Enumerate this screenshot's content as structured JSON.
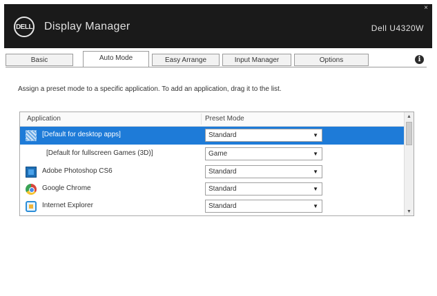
{
  "titlebar": {
    "logo_text": "DELL",
    "app_title": "Display Manager",
    "monitor_model": "Dell U4320W",
    "close_glyph": "×"
  },
  "tabs": [
    {
      "label": "Basic",
      "active": false
    },
    {
      "label": "Auto Mode",
      "active": true
    },
    {
      "label": "Easy Arrange",
      "active": false
    },
    {
      "label": "Input Manager",
      "active": false
    },
    {
      "label": "Options",
      "active": false
    }
  ],
  "info_glyph": "i",
  "instruction": "Assign a preset mode to a specific application. To add an application, drag it to the list.",
  "list": {
    "header_application": "Application",
    "header_preset": "Preset Mode",
    "rows": [
      {
        "label": "[Default for desktop apps]",
        "preset": "Standard",
        "icon": "default-apps-icon",
        "selected": true
      },
      {
        "label": "[Default for fullscreen Games (3D)]",
        "preset": "Game",
        "icon": "none",
        "selected": false
      },
      {
        "label": "Adobe Photoshop CS6",
        "preset": "Standard",
        "icon": "photoshop-icon",
        "selected": false
      },
      {
        "label": "Google Chrome",
        "preset": "Standard",
        "icon": "chrome-icon",
        "selected": false
      },
      {
        "label": "Internet Explorer",
        "preset": "Standard",
        "icon": "internet-explorer-icon",
        "selected": false
      }
    ]
  },
  "scrollbar": {
    "up_glyph": "▲",
    "down_glyph": "▼"
  },
  "colors": {
    "titlebar": "#1a1a1a",
    "selection": "#1e7bd8"
  }
}
